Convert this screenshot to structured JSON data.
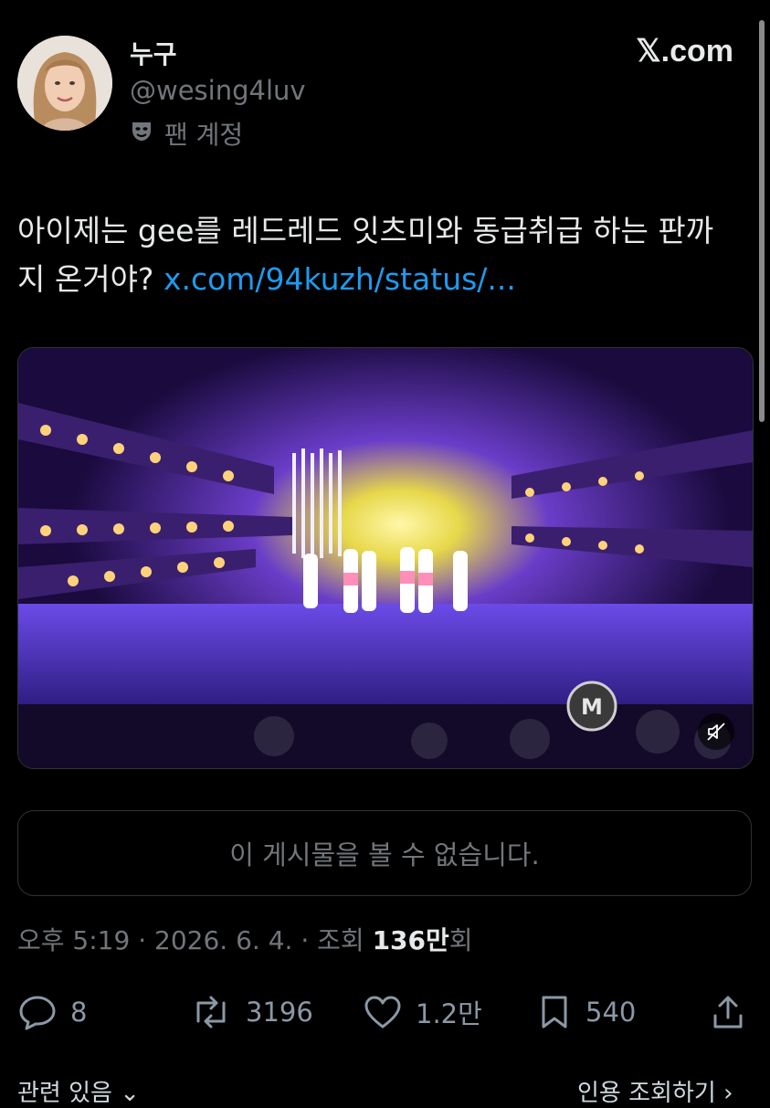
{
  "author": {
    "display_name": "누구",
    "handle": "@wesing4luv",
    "account_label": "팬 계정",
    "account_icon": "theater-mask-icon",
    "avatar_icon": "profile-avatar"
  },
  "brand": {
    "logo_text": "𝕏.com"
  },
  "tweet": {
    "text": "아이제는 gee를 레드레드 잇츠미와 동급취급 하는 판까지 온거야? ",
    "link": "x.com/94kuzh/status/..."
  },
  "media": {
    "type": "video",
    "mute_icon": "speaker-muted-icon",
    "watermark_icon": "broadcast-logo-icon"
  },
  "quoted_post": {
    "unavailable_text": "이 게시물을 볼 수 없습니다."
  },
  "meta": {
    "time": "오후 5:19",
    "date": "2026. 6. 4.",
    "views_prefix": "조회",
    "views_value": "136만",
    "views_suffix": "회",
    "separator": "·"
  },
  "actions": {
    "reply_count": "8",
    "retweet_count": "3196",
    "like_count": "1.2만",
    "bookmark_count": "540"
  },
  "bottom": {
    "left_label": "관련 있음",
    "right_label": "인용 조회하기"
  },
  "colors": {
    "link": "#1d9bf0",
    "muted": "#71767b",
    "background": "#000000"
  }
}
